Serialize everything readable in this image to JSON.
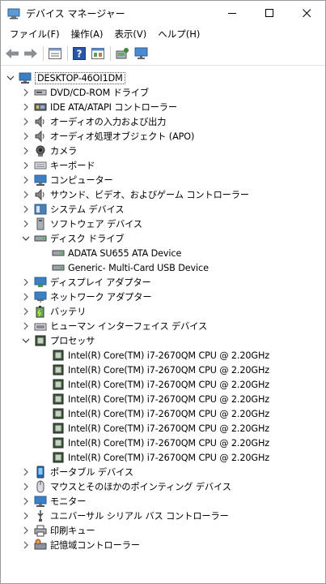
{
  "window": {
    "title": "デバイス マネージャー"
  },
  "menu": [
    "ファイル(F)",
    "操作(A)",
    "表示(V)",
    "ヘルプ(H)"
  ],
  "toolbar": [
    "back-icon",
    "forward-icon",
    "properties-icon",
    "help-icon",
    "view-icon",
    "scan-icon",
    "monitor-icon"
  ],
  "tree": {
    "root": "DESKTOP-46OI1DM",
    "categories": [
      {
        "label": "DVD/CD-ROM ドライブ",
        "icon": "dvd-drive-icon",
        "expanded": false
      },
      {
        "label": "IDE ATA/ATAPI コントローラー",
        "icon": "ide-controller-icon",
        "expanded": false
      },
      {
        "label": "オーディオの入力および出力",
        "icon": "speaker-icon",
        "expanded": false
      },
      {
        "label": "オーディオ処理オブジェクト (APO)",
        "icon": "speaker-icon",
        "expanded": false
      },
      {
        "label": "カメラ",
        "icon": "camera-icon",
        "expanded": false
      },
      {
        "label": "キーボード",
        "icon": "keyboard-icon",
        "expanded": false
      },
      {
        "label": "コンピューター",
        "icon": "computer-icon",
        "expanded": false
      },
      {
        "label": "サウンド、ビデオ、およびゲーム コントローラー",
        "icon": "speaker-icon",
        "expanded": false
      },
      {
        "label": "システム デバイス",
        "icon": "system-device-icon",
        "expanded": false
      },
      {
        "label": "ソフトウェア デバイス",
        "icon": "software-device-icon",
        "expanded": false
      },
      {
        "label": "ディスク ドライブ",
        "icon": "disk-drive-icon",
        "expanded": true,
        "children": [
          "ADATA SU655 ATA Device",
          "Generic- Multi-Card USB Device"
        ]
      },
      {
        "label": "ディスプレイ アダプター",
        "icon": "display-adapter-icon",
        "expanded": false
      },
      {
        "label": "ネットワーク アダプター",
        "icon": "network-adapter-icon",
        "expanded": false
      },
      {
        "label": "バッテリ",
        "icon": "battery-icon",
        "expanded": false
      },
      {
        "label": "ヒューマン インターフェイス デバイス",
        "icon": "hid-icon",
        "expanded": false
      },
      {
        "label": "プロセッサ",
        "icon": "processor-icon",
        "expanded": true,
        "children": [
          "Intel(R) Core(TM) i7-2670QM CPU @ 2.20GHz",
          "Intel(R) Core(TM) i7-2670QM CPU @ 2.20GHz",
          "Intel(R) Core(TM) i7-2670QM CPU @ 2.20GHz",
          "Intel(R) Core(TM) i7-2670QM CPU @ 2.20GHz",
          "Intel(R) Core(TM) i7-2670QM CPU @ 2.20GHz",
          "Intel(R) Core(TM) i7-2670QM CPU @ 2.20GHz",
          "Intel(R) Core(TM) i7-2670QM CPU @ 2.20GHz",
          "Intel(R) Core(TM) i7-2670QM CPU @ 2.20GHz"
        ]
      },
      {
        "label": "ポータブル デバイス",
        "icon": "portable-device-icon",
        "expanded": false
      },
      {
        "label": "マウスとそのほかのポインティング デバイス",
        "icon": "mouse-icon",
        "expanded": false
      },
      {
        "label": "モニター",
        "icon": "monitor-icon",
        "expanded": false
      },
      {
        "label": "ユニバーサル シリアル バス コントローラー",
        "icon": "usb-icon",
        "expanded": false
      },
      {
        "label": "印刷キュー",
        "icon": "printer-icon",
        "expanded": false
      },
      {
        "label": "記憶域コントローラー",
        "icon": "storage-controller-icon",
        "expanded": false
      }
    ]
  }
}
